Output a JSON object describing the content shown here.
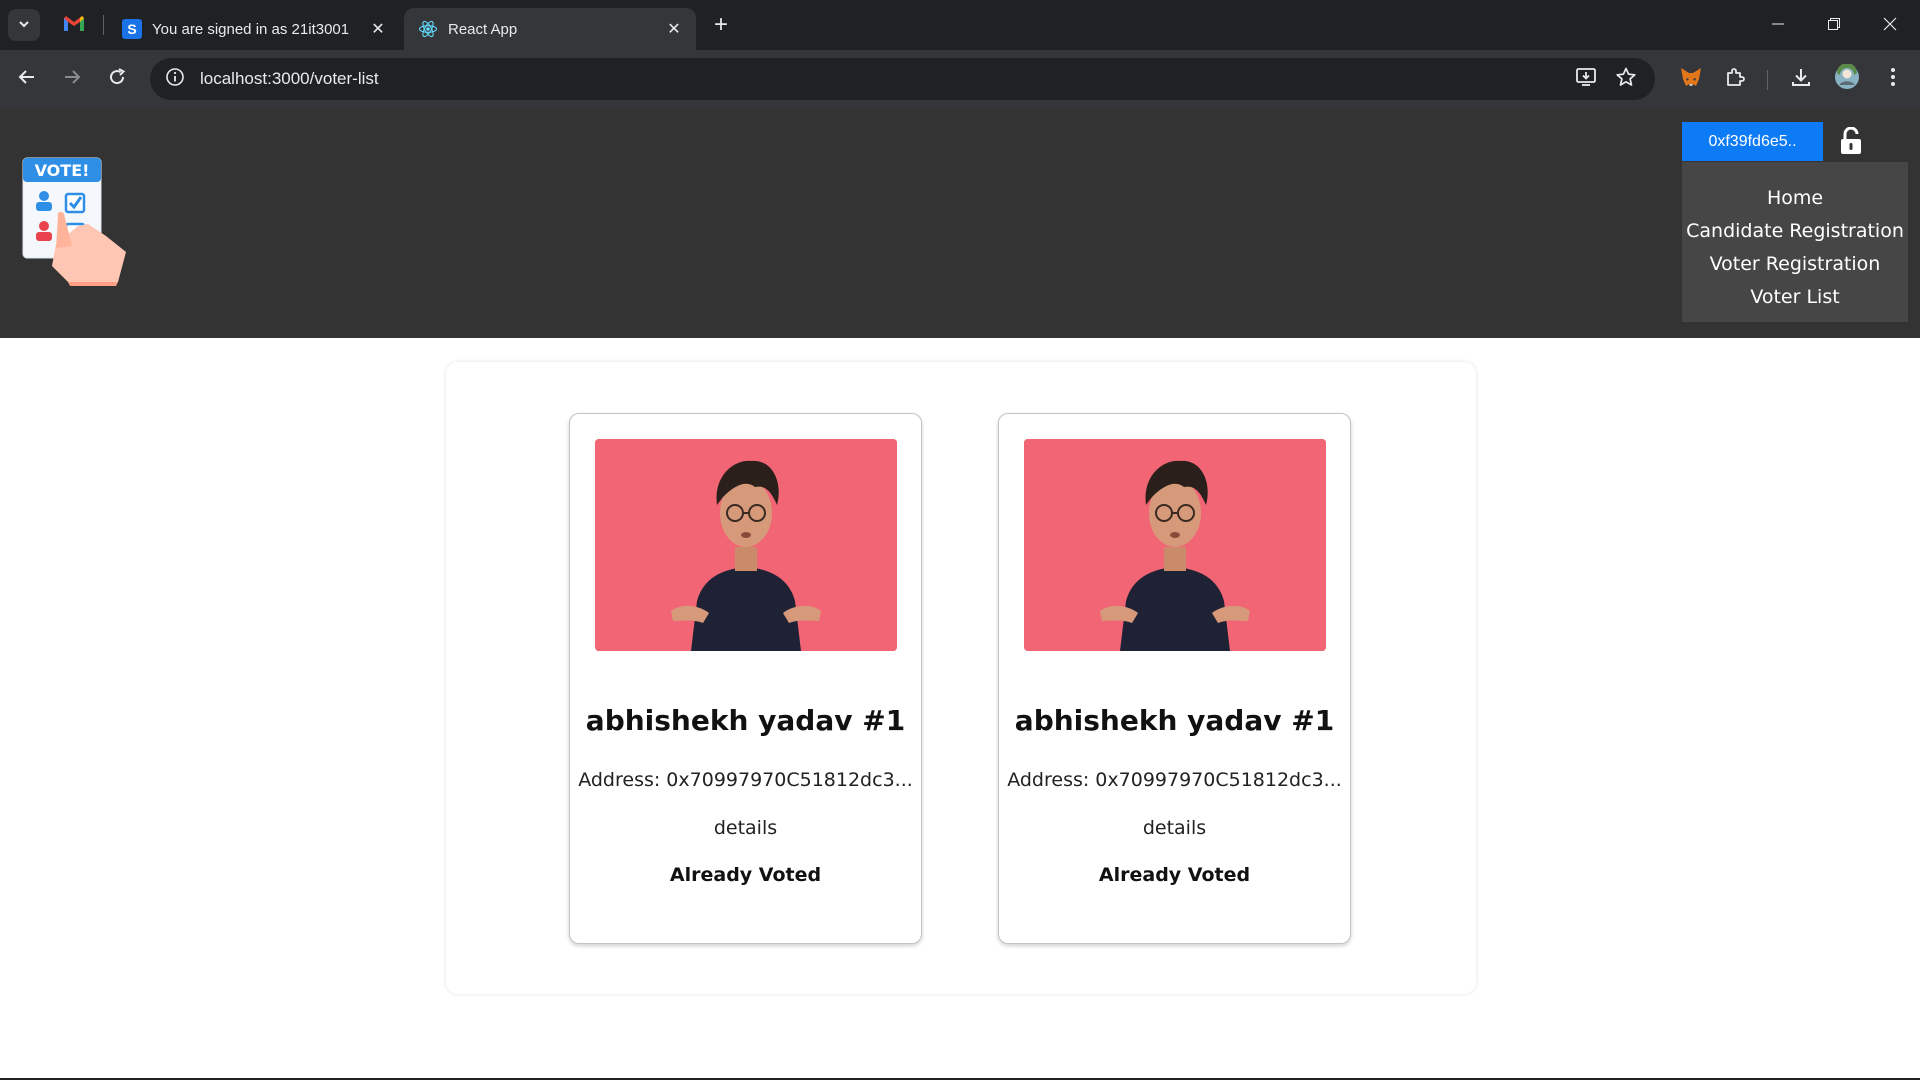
{
  "browser": {
    "tabs": [
      {
        "title": "You are signed in as 21it3001",
        "favicon": "s-icon",
        "active": false
      },
      {
        "title": "React App",
        "favicon": "react-icon",
        "active": true
      }
    ],
    "url": "localhost:3000/voter-list"
  },
  "header": {
    "logo_text": "VOTE!",
    "wallet_button": "0xf39fd6e5..",
    "nav": [
      "Home",
      "Candidate Registration",
      "Voter Registration",
      "Voter List"
    ]
  },
  "voters": [
    {
      "name": "abhishekh yadav #1",
      "address": "Address: 0x70997970C51812dc3...",
      "details": "details",
      "status": "Already Voted"
    },
    {
      "name": "abhishekh yadav #1",
      "address": "Address: 0x70997970C51812dc3...",
      "details": "details",
      "status": "Already Voted"
    }
  ],
  "colors": {
    "header_bg": "#333333",
    "nav_bg": "#464646",
    "wallet_button": "#0d7bf5",
    "photo_bg": "#f26574"
  }
}
